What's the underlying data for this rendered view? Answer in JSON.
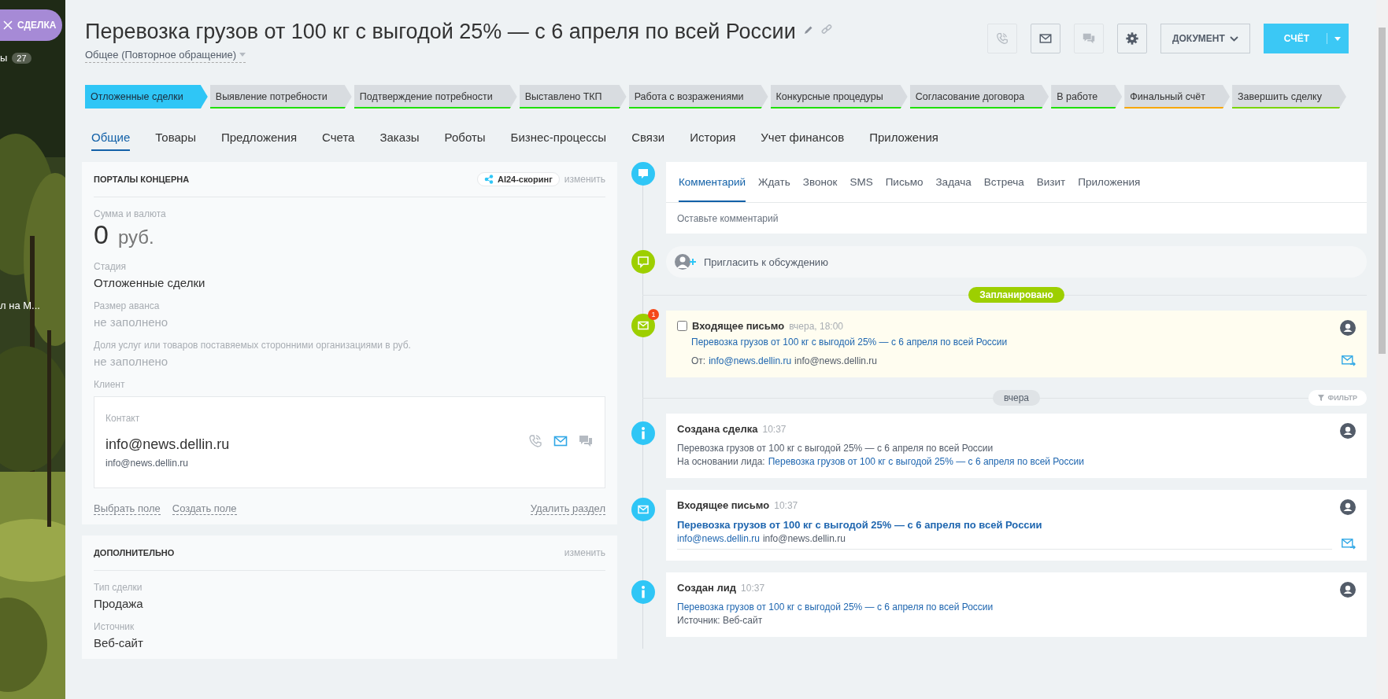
{
  "side_strip": {
    "tab_label": "СДЕЛКА",
    "items": [
      {
        "label": "ы",
        "count": "27"
      },
      {
        "label": "л на М..."
      }
    ]
  },
  "header": {
    "title": "Перевозка грузов от 100 кг с выгодой 25% — с 6 апреля по всей России",
    "category": "Общее (Повторное обращение)",
    "icon_buttons": [
      {
        "kind": "call",
        "disabled": true
      },
      {
        "kind": "mail",
        "disabled": false
      },
      {
        "kind": "chat",
        "disabled": true
      },
      {
        "kind": "settings",
        "disabled": false
      }
    ],
    "document_button": "ДОКУМЕНТ",
    "invoice_button": "СЧЁТ"
  },
  "stages": [
    {
      "label": "Отложенные сделки",
      "selected": true,
      "color": "#2fc6f6"
    },
    {
      "label": "Выявление потребности",
      "selected": false,
      "color": "#1fe000"
    },
    {
      "label": "Подтверждение потребности",
      "selected": false,
      "color": "#1fe000"
    },
    {
      "label": "Выставлено ТКП",
      "selected": false,
      "color": "#1fe000"
    },
    {
      "label": "Работа с возражениями",
      "selected": false,
      "color": "#1fe000"
    },
    {
      "label": "Конкурсные процедуры",
      "selected": false,
      "color": "#1fe000"
    },
    {
      "label": "Согласование договора",
      "selected": false,
      "color": "#1fe000"
    },
    {
      "label": "В работе",
      "selected": false,
      "color": "#1fe000"
    },
    {
      "label": "Финальный счёт",
      "selected": false,
      "color": "#f7a700"
    },
    {
      "label": "Завершить сделку",
      "selected": false,
      "color": "#7bd500"
    }
  ],
  "tabs": [
    {
      "label": "Общие",
      "selected": true
    },
    {
      "label": "Товары",
      "selected": false
    },
    {
      "label": "Предложения",
      "selected": false
    },
    {
      "label": "Счета",
      "selected": false
    },
    {
      "label": "Заказы",
      "selected": false
    },
    {
      "label": "Роботы",
      "selected": false
    },
    {
      "label": "Бизнес-процессы",
      "selected": false
    },
    {
      "label": "Связи",
      "selected": false
    },
    {
      "label": "История",
      "selected": false
    },
    {
      "label": "Учет финансов",
      "selected": false
    },
    {
      "label": "Приложения",
      "selected": false
    }
  ],
  "sections": [
    {
      "title": "ПОРТАЛЫ КОНЦЕРНА",
      "badge": "AI24-скоринг",
      "edit": "изменить",
      "fields": [
        {
          "kind": "money",
          "label": "Сумма и валюта",
          "value": "0",
          "currency": "руб."
        },
        {
          "kind": "text",
          "label": "Стадия",
          "value": "Отложенные сделки"
        },
        {
          "kind": "empty",
          "label": "Размер аванса",
          "value": "не заполнено"
        },
        {
          "kind": "empty",
          "label": "Доля услуг или товаров поставяемых сторонними организациями в руб.",
          "value": "не заполнено"
        },
        {
          "kind": "client",
          "label": "Клиент",
          "contact_label": "Контакт",
          "name": "info@news.dellin.ru",
          "email": "info@news.dellin.ru"
        }
      ],
      "footer": {
        "left": [
          "Выбрать поле",
          "Создать поле"
        ],
        "right": "Удалить раздел"
      }
    },
    {
      "title": "ДОПОЛНИТЕЛЬНО",
      "edit": "изменить",
      "fields": [
        {
          "kind": "text",
          "label": "Тип сделки",
          "value": "Продажа"
        },
        {
          "kind": "text",
          "label": "Источник",
          "value": "Веб-сайт"
        }
      ]
    }
  ],
  "timeline": {
    "editor": {
      "tabs": [
        {
          "label": "Комментарий",
          "selected": true
        },
        {
          "label": "Ждать",
          "selected": false
        },
        {
          "label": "Звонок",
          "selected": false
        },
        {
          "label": "SMS",
          "selected": false
        },
        {
          "label": "Письмо",
          "selected": false
        },
        {
          "label": "Задача",
          "selected": false
        },
        {
          "label": "Встреча",
          "selected": false
        },
        {
          "label": "Визит",
          "selected": false
        },
        {
          "label": "Приложения",
          "selected": false
        }
      ],
      "placeholder": "Оставьте комментарий"
    },
    "invite": "Пригласить к обсуждению",
    "planned_label": "Запланировано",
    "planned": [
      {
        "title": "Входящее письмо",
        "time": "вчера, 18:00",
        "checked": false,
        "notification_count": "1",
        "subject": "Перевозка грузов от 100 кг с выгодой 25% — с 6 апреля по всей России",
        "from_label": "От:",
        "from_link": "info@news.dellin.ru",
        "from_text": "info@news.dellin.ru"
      }
    ],
    "day_label": "вчера",
    "filter": "ФИЛЬТР",
    "history": [
      {
        "kind": "info",
        "title": "Создана сделка",
        "time": "10:37",
        "lines": [
          [
            {
              "kind": "plain",
              "text": "Перевозка грузов от 100 кг с выгодой 25% — с 6 апреля по всей России"
            }
          ],
          [
            {
              "kind": "plain",
              "text": "На основании лида:"
            },
            {
              "kind": "link",
              "text": "Перевозка грузов от 100 кг с выгодой 25% — с 6 апреля по всей России"
            }
          ]
        ]
      },
      {
        "kind": "email",
        "title": "Входящее письмо",
        "time": "10:37",
        "lines": [
          [
            {
              "kind": "bold-link",
              "text": "Перевозка грузов от 100 кг с выгодой 25% — с 6 апреля по всей России"
            }
          ],
          [
            {
              "kind": "link",
              "text": "info@news.dellin.ru"
            },
            {
              "kind": "plain",
              "text": "info@news.dellin.ru"
            }
          ]
        ]
      },
      {
        "kind": "info",
        "title": "Создан лид",
        "time": "10:37",
        "lines": [
          [
            {
              "kind": "link",
              "text": "Перевозка грузов от 100 кг с выгодой 25% — с 6 апреля по всей России"
            }
          ],
          [
            {
              "kind": "plain",
              "text": "Источник: Веб-сайт"
            }
          ]
        ]
      }
    ]
  }
}
